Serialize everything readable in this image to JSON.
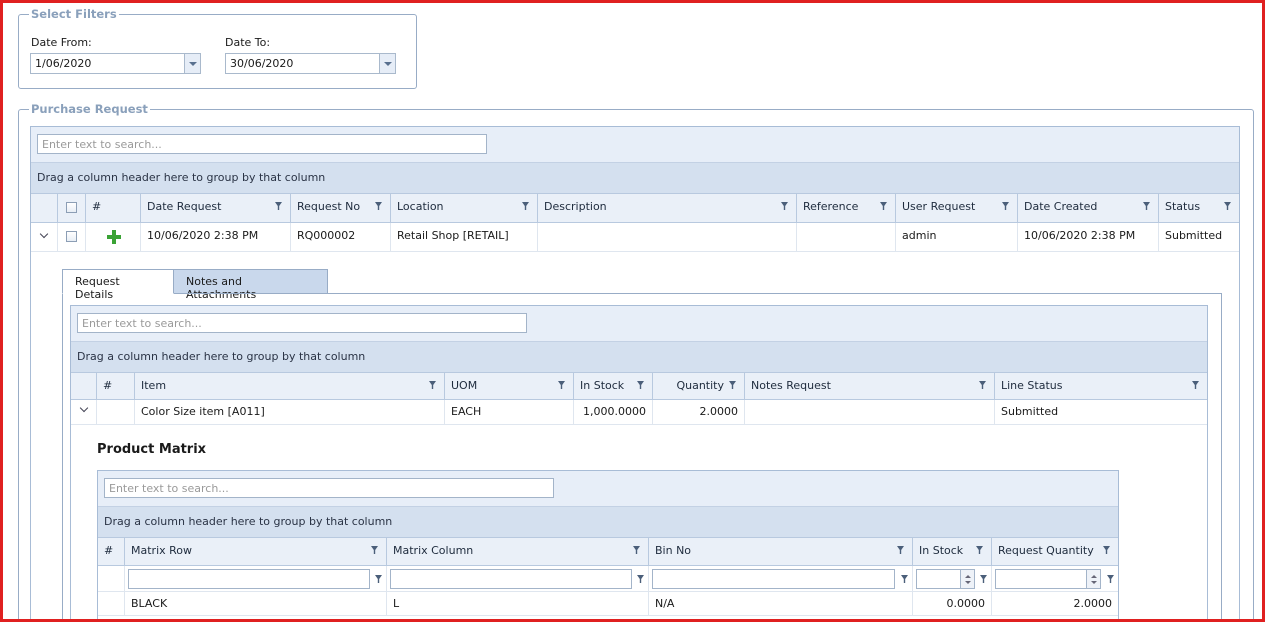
{
  "filters": {
    "legend": "Select Filters",
    "date_from_label": "Date From:",
    "date_from_value": "1/06/2020",
    "date_to_label": "Date To:",
    "date_to_value": "30/06/2020"
  },
  "purchase_request": {
    "legend": "Purchase Request",
    "search_placeholder": "Enter text to search...",
    "group_hint": "Drag a column header here to group by that column",
    "columns": {
      "hash": "#",
      "date_request": "Date Request",
      "request_no": "Request No",
      "location": "Location",
      "description": "Description",
      "reference": "Reference",
      "user_request": "User Request",
      "date_created": "Date Created",
      "status": "Status"
    },
    "row": {
      "date_request": "10/06/2020 2:38 PM",
      "request_no": "RQ000002",
      "location": "Retail Shop [RETAIL]",
      "description": "",
      "reference": "",
      "user_request": "admin",
      "date_created": "10/06/2020 2:38 PM",
      "status": "Submitted"
    }
  },
  "detail_tabs": {
    "request_details": "Request Details",
    "notes_attachments": "Notes and Attachments"
  },
  "request_details": {
    "search_placeholder": "Enter text to search...",
    "group_hint": "Drag a column header here to group by that column",
    "columns": {
      "hash": "#",
      "item": "Item",
      "uom": "UOM",
      "in_stock": "In Stock",
      "quantity": "Quantity",
      "notes_request": "Notes Request",
      "line_status": "Line Status"
    },
    "row": {
      "item": "Color Size item [A011]",
      "uom": "EACH",
      "in_stock": "1,000.0000",
      "quantity": "2.0000",
      "notes_request": "",
      "line_status": "Submitted"
    }
  },
  "product_matrix": {
    "title": "Product Matrix",
    "search_placeholder": "Enter text to search...",
    "group_hint": "Drag a column header here to group by that column",
    "columns": {
      "hash": "#",
      "matrix_row": "Matrix Row",
      "matrix_column": "Matrix Column",
      "bin_no": "Bin No",
      "in_stock": "In Stock",
      "request_quantity": "Request Quantity"
    },
    "row": {
      "matrix_row": "BLACK",
      "matrix_column": "L",
      "bin_no": "N/A",
      "in_stock": "0.0000",
      "request_quantity": "2.0000"
    }
  },
  "colors": {
    "frame_border": "#e02020",
    "header_bg": "#eaf0f8",
    "group_bg": "#d4e0ef",
    "search_bg": "#e7eef8",
    "add_icon": "#3aa335"
  }
}
